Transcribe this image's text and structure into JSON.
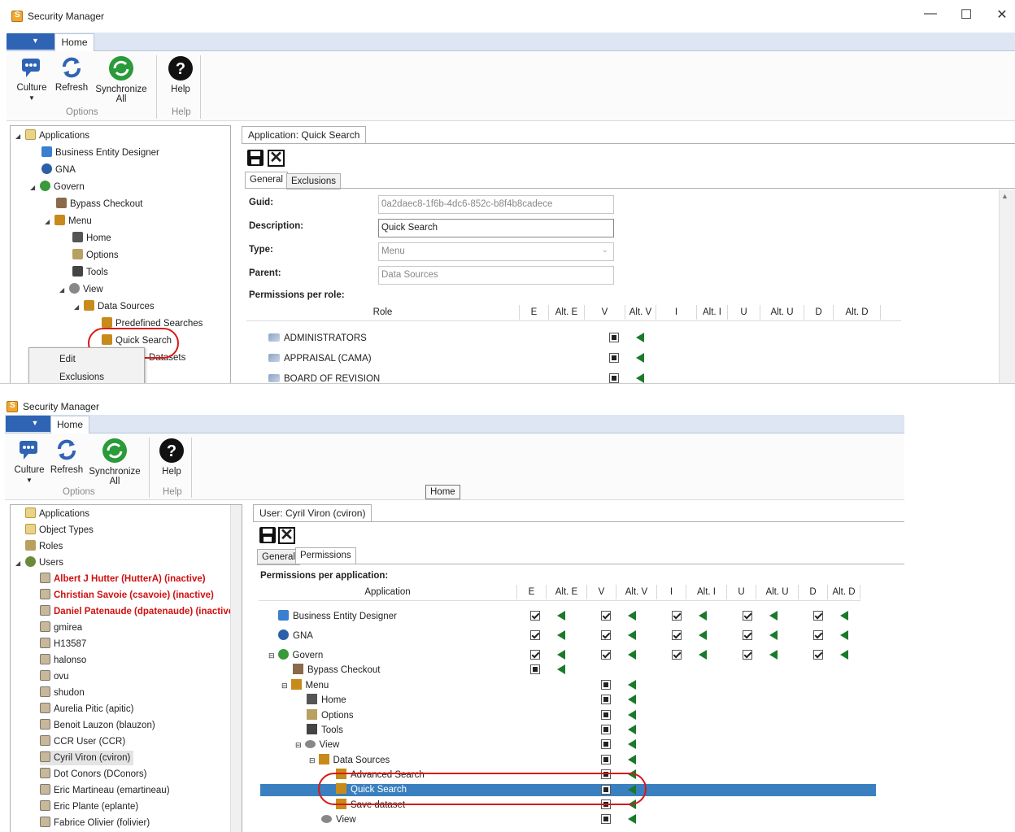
{
  "top": {
    "title": "Security Manager",
    "tab_home": "Home",
    "ribbon": {
      "culture": "Culture",
      "refresh": "Refresh",
      "sync_1": "Synchronize",
      "sync_2": "All",
      "help": "Help",
      "group_options": "Options",
      "group_help": "Help"
    },
    "tree": [
      {
        "label": "Applications"
      },
      {
        "label": "Business Entity Designer"
      },
      {
        "label": "GNA"
      },
      {
        "label": "Govern"
      },
      {
        "label": "Bypass Checkout"
      },
      {
        "label": "Menu"
      },
      {
        "label": "Home"
      },
      {
        "label": "Options"
      },
      {
        "label": "Tools"
      },
      {
        "label": "View"
      },
      {
        "label": "Data Sources"
      },
      {
        "label": "Predefined Searches"
      },
      {
        "label": "Quick Search"
      },
      {
        "label": "Datasets"
      }
    ],
    "context_menu": [
      "Edit",
      "Exclusions"
    ],
    "doc_tab": "Application: Quick Search",
    "subtabs": [
      "General",
      "Exclusions"
    ],
    "form": {
      "guid_label": "Guid:",
      "guid_value": "0a2daec8-1f6b-4dc6-852c-b8f4b8cadece",
      "description_label": "Description:",
      "description_value": "Quick Search",
      "type_label": "Type:",
      "type_value": "Menu",
      "parent_label": "Parent:",
      "parent_value": "Data Sources",
      "permissions_label": "Permissions per role:"
    },
    "columns": [
      "Role",
      "E",
      "Alt. E",
      "V",
      "Alt. V",
      "I",
      "Alt. I",
      "U",
      "Alt. U",
      "D",
      "Alt. D"
    ],
    "roles": [
      "ADMINISTRATORS",
      "APPRAISAL (CAMA)",
      "BOARD OF REVISION"
    ]
  },
  "bottom": {
    "title": "Security Manager",
    "tab_home": "Home",
    "tooltip": "Home",
    "ribbon": {
      "culture": "Culture",
      "refresh": "Refresh",
      "sync_1": "Synchronize",
      "sync_2": "All",
      "help": "Help",
      "group_options": "Options",
      "group_help": "Help"
    },
    "tree": [
      {
        "label": "Applications"
      },
      {
        "label": "Object Types"
      },
      {
        "label": "Roles"
      },
      {
        "label": "Users"
      },
      {
        "label": "Albert J Hutter (HutterA) (inactive)"
      },
      {
        "label": "Christian Savoie (csavoie) (inactive)"
      },
      {
        "label": "Daniel Patenaude (dpatenaude) (inactive)"
      },
      {
        "label": "gmirea"
      },
      {
        "label": "H13587"
      },
      {
        "label": "halonso"
      },
      {
        "label": "ovu"
      },
      {
        "label": "shudon"
      },
      {
        "label": "Aurelia Pitic (apitic)"
      },
      {
        "label": "Benoit Lauzon (blauzon)"
      },
      {
        "label": "CCR User (CCR)"
      },
      {
        "label": "Cyril Viron (cviron)"
      },
      {
        "label": "Dot Conors (DConors)"
      },
      {
        "label": "Eric Martineau (emartineau)"
      },
      {
        "label": "Eric Plante (eplante)"
      },
      {
        "label": "Fabrice Olivier (folivier)"
      }
    ],
    "doc_tab": "User: Cyril Viron (cviron)",
    "subtabs": [
      "General",
      "Permissions"
    ],
    "permissions_label": "Permissions per application:",
    "columns": [
      "Application",
      "E",
      "Alt. E",
      "V",
      "Alt. V",
      "I",
      "Alt. I",
      "U",
      "Alt. U",
      "D",
      "Alt. D"
    ],
    "rows": [
      {
        "label": "Business Entity Designer"
      },
      {
        "label": "GNA"
      },
      {
        "label": "Govern"
      },
      {
        "label": "Bypass Checkout"
      },
      {
        "label": "Menu"
      },
      {
        "label": "Home"
      },
      {
        "label": "Options"
      },
      {
        "label": "Tools"
      },
      {
        "label": "View"
      },
      {
        "label": "Data Sources"
      },
      {
        "label": "Advanced Search"
      },
      {
        "label": "Quick Search"
      },
      {
        "label": "Save dataset"
      },
      {
        "label": "View"
      }
    ]
  },
  "colors": {
    "accent": "#2f63b4",
    "selection": "#3a7fbf",
    "grant_arrow": "#1a7a2a",
    "highlight": "#d81818"
  }
}
